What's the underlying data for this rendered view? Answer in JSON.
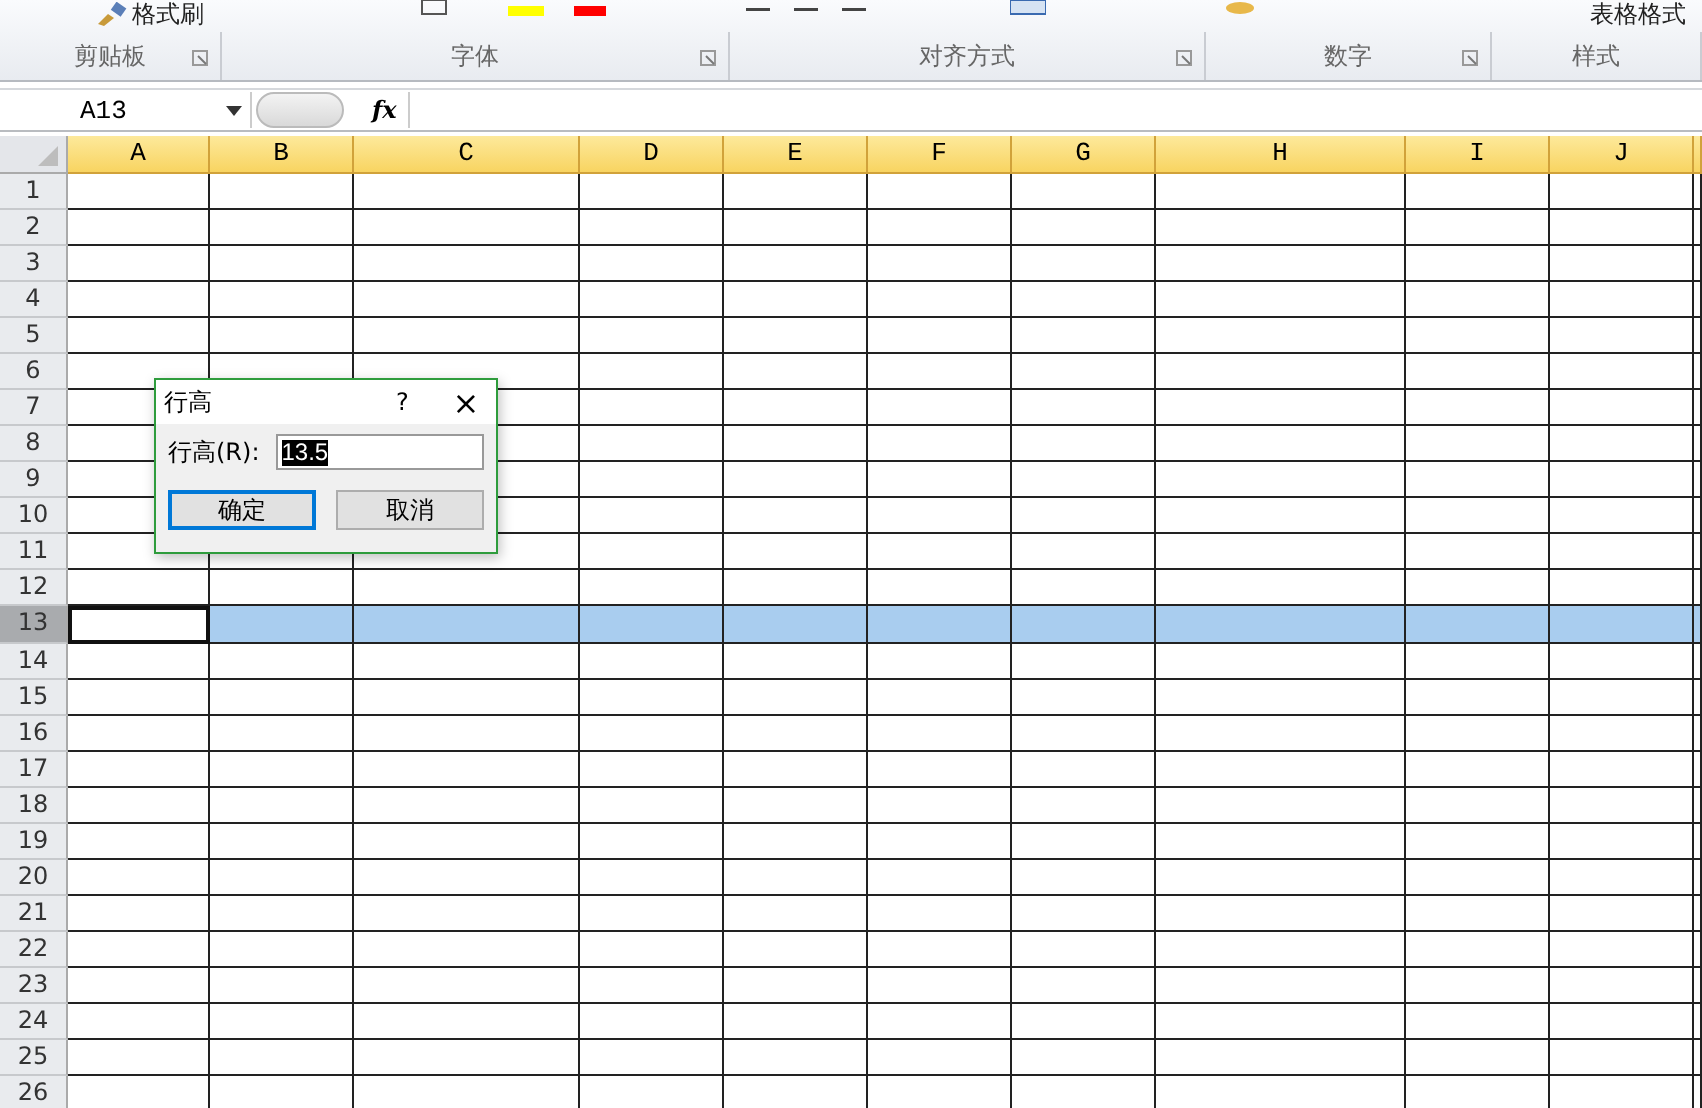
{
  "ribbon": {
    "top_texts": [
      {
        "kind": "brush",
        "text": "格式刷"
      },
      {
        "kind": "table",
        "text": "表格格式"
      }
    ],
    "groups": [
      {
        "label": "剪贴板",
        "launcher": true
      },
      {
        "label": "字体",
        "launcher": true
      },
      {
        "label": "对齐方式",
        "launcher": true
      },
      {
        "label": "数字",
        "launcher": true
      },
      {
        "label": "样式",
        "launcher": false
      }
    ]
  },
  "name_box": {
    "value": "A13"
  },
  "formula_bar": {
    "fx": "fx"
  },
  "columns": [
    {
      "label": "A"
    },
    {
      "label": "B"
    },
    {
      "label": "C"
    },
    {
      "label": "D"
    },
    {
      "label": "E"
    },
    {
      "label": "F"
    },
    {
      "label": "G"
    },
    {
      "label": "H"
    },
    {
      "label": "I"
    },
    {
      "label": "J"
    }
  ],
  "rows": [
    {
      "label": "1",
      "selected": false
    },
    {
      "label": "2",
      "selected": false
    },
    {
      "label": "3",
      "selected": false
    },
    {
      "label": "4",
      "selected": false
    },
    {
      "label": "5",
      "selected": false
    },
    {
      "label": "6",
      "selected": false
    },
    {
      "label": "7",
      "selected": false
    },
    {
      "label": "8",
      "selected": false
    },
    {
      "label": "9",
      "selected": false
    },
    {
      "label": "10",
      "selected": false
    },
    {
      "label": "11",
      "selected": false
    },
    {
      "label": "12",
      "selected": false
    },
    {
      "label": "13",
      "selected": true
    },
    {
      "label": "14",
      "selected": false
    },
    {
      "label": "15",
      "selected": false
    },
    {
      "label": "16",
      "selected": false
    },
    {
      "label": "17",
      "selected": false
    },
    {
      "label": "18",
      "selected": false
    },
    {
      "label": "19",
      "selected": false
    },
    {
      "label": "20",
      "selected": false
    },
    {
      "label": "21",
      "selected": false
    },
    {
      "label": "22",
      "selected": false
    },
    {
      "label": "23",
      "selected": false
    },
    {
      "label": "24",
      "selected": false
    },
    {
      "label": "25",
      "selected": false
    },
    {
      "label": "26",
      "selected": false
    }
  ],
  "dialog": {
    "title": "行高",
    "help": "?",
    "close": "×",
    "field_label": "行高(R):",
    "value": "13.5",
    "buttons": [
      {
        "label": "确定",
        "selected": true
      },
      {
        "label": "取消",
        "selected": false
      }
    ]
  }
}
